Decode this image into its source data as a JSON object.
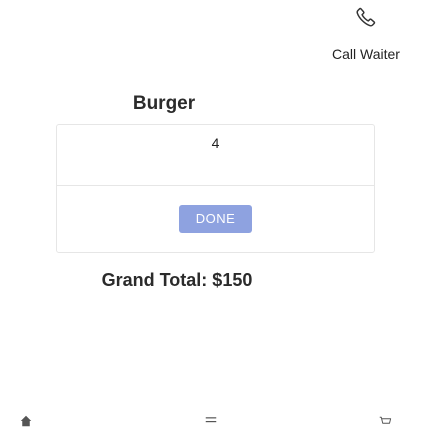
{
  "header": {
    "call_waiter": {
      "icon": "phone-icon",
      "label": "Call Waiter"
    }
  },
  "order": {
    "item_name": "Burger",
    "quantity": "4",
    "done_label": "DONE"
  },
  "summary": {
    "grand_total": "Grand Total: $150"
  },
  "bottom_nav": {
    "items": [
      {
        "icon": "home-icon"
      },
      {
        "icon": "menu-icon"
      },
      {
        "icon": "cart-icon"
      }
    ]
  },
  "colors": {
    "done_button": "#8ea2e0",
    "border": "#e6e6e6",
    "text": "#222222"
  }
}
